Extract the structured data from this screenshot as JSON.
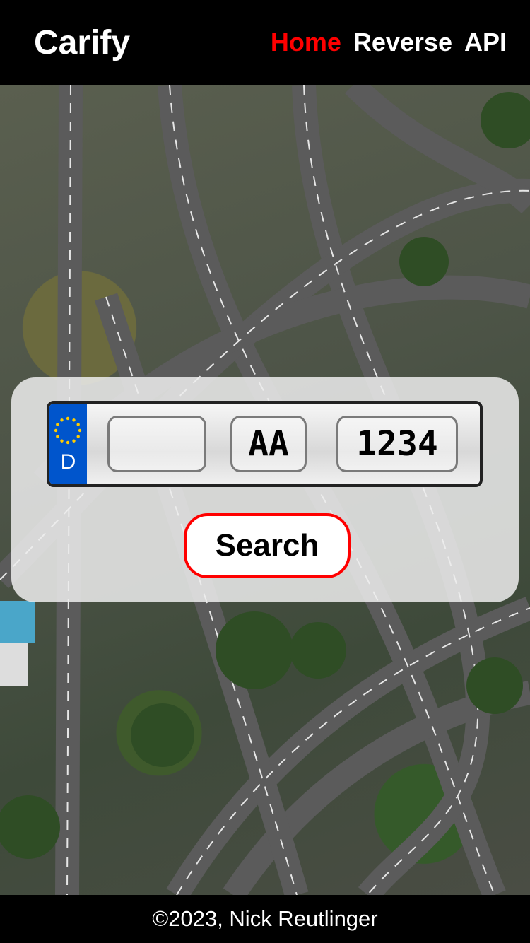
{
  "header": {
    "brand": "Carify",
    "nav": [
      {
        "label": "Home",
        "active": true
      },
      {
        "label": "Reverse",
        "active": false
      },
      {
        "label": "API",
        "active": false
      }
    ]
  },
  "background": {
    "description_icon": "highway-interchange-aerial-photo"
  },
  "plate": {
    "country_code": "D",
    "eu_flag_icon": "eu-stars-icon",
    "eu_color": "#0055cc",
    "district": {
      "value": "",
      "placeholder": ""
    },
    "letters": {
      "value": "AA",
      "placeholder": ""
    },
    "numbers": {
      "value": "1234",
      "placeholder": ""
    }
  },
  "search": {
    "label": "Search",
    "border_color": "#ff0000"
  },
  "footer": {
    "text": "©2023, Nick Reutlinger"
  },
  "colors": {
    "accent": "#ff0000",
    "header_bg": "#000000"
  }
}
